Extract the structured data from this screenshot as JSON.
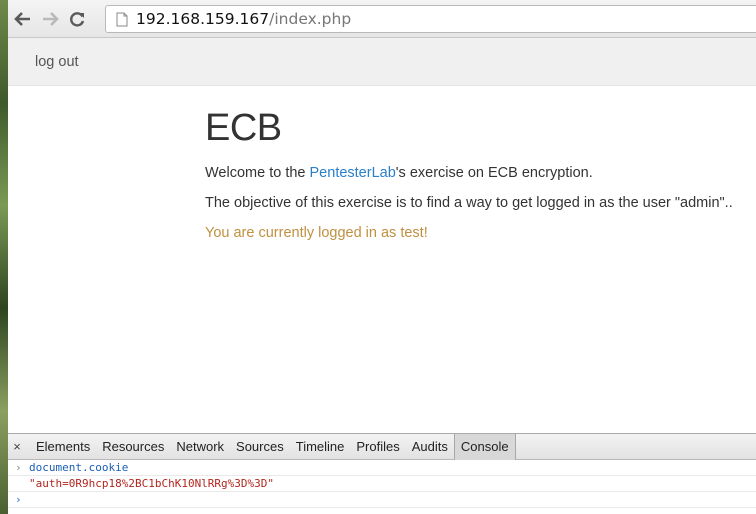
{
  "browser": {
    "url_host": "192.168.159.167",
    "url_path": "/index.php"
  },
  "navbar": {
    "logout_label": "log out"
  },
  "main": {
    "heading": "ECB",
    "welcome_prefix": "Welcome to the ",
    "welcome_link": "PentesterLab",
    "welcome_suffix": "'s exercise on ECB encryption.",
    "objective": "The objective of this exercise is to find a way to get logged in as the user \"admin\"..",
    "status": "You are currently logged in as test!"
  },
  "devtools": {
    "close_label": "×",
    "tabs": [
      "Elements",
      "Resources",
      "Network",
      "Sources",
      "Timeline",
      "Profiles",
      "Audits",
      "Console"
    ],
    "active_tab": "Console",
    "console": {
      "input": "document.cookie",
      "result": "\"auth=0R9hcp18%2BC1bChK10NlRRg%3D%3D\"",
      "prompt_symbol": "›"
    }
  },
  "colors": {
    "link": "#2a7fc9",
    "status": "#c09040",
    "console_input": "#1a5fb4",
    "console_result": "#b3261e"
  },
  "icons": {
    "back": "back-arrow-icon",
    "forward": "forward-arrow-icon",
    "reload": "reload-icon",
    "page": "page-icon"
  }
}
